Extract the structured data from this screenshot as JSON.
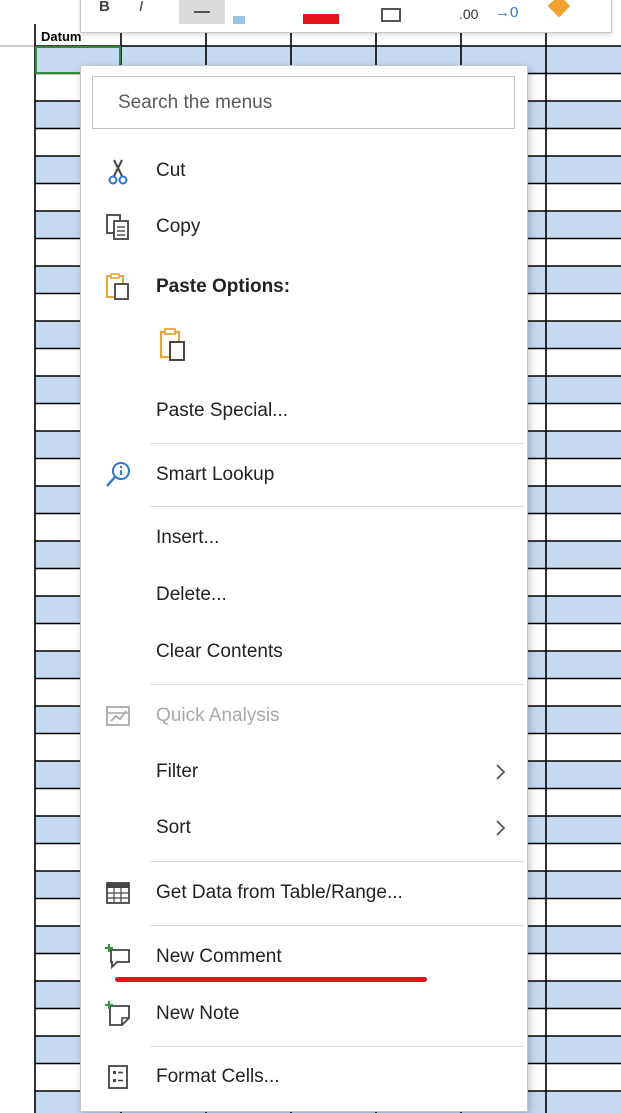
{
  "sheet": {
    "header_label": "Datum"
  },
  "colors": {
    "row_fill": "#c5d9f1",
    "grid_line": "#000000",
    "active_cell_border": "#2e8b3d",
    "annotation": "#e0151b",
    "paste_icon": "#e8a33c",
    "lookup_icon": "#2f76c9",
    "cut_icon": "#2f76c9"
  },
  "toolbar": {
    "number_format_glyph": ".00",
    "decrease_decimal_glyph": "→0"
  },
  "menu": {
    "search_placeholder": "Search the menus",
    "items": {
      "cut": "Cut",
      "copy": "Copy",
      "paste_options": "Paste Options:",
      "paste_special": "Paste Special...",
      "smart_lookup": "Smart Lookup",
      "insert": "Insert...",
      "delete": "Delete...",
      "clear_contents": "Clear Contents",
      "quick_analysis": "Quick Analysis",
      "filter": "Filter",
      "sort": "Sort",
      "get_data": "Get Data from Table/Range...",
      "new_comment": "New Comment",
      "new_note": "New Note",
      "format_cells": "Format Cells..."
    },
    "icons": {
      "cut": "scissors-icon",
      "copy": "copy-icon",
      "paste": "clipboard-paste-icon",
      "smart_lookup": "search-info-icon",
      "quick_analysis": "quick-analysis-icon",
      "get_data": "table-icon",
      "new_comment": "new-comment-icon",
      "new_note": "new-note-icon",
      "format_cells": "format-cells-icon",
      "submenu": "chevron-right-icon"
    }
  }
}
